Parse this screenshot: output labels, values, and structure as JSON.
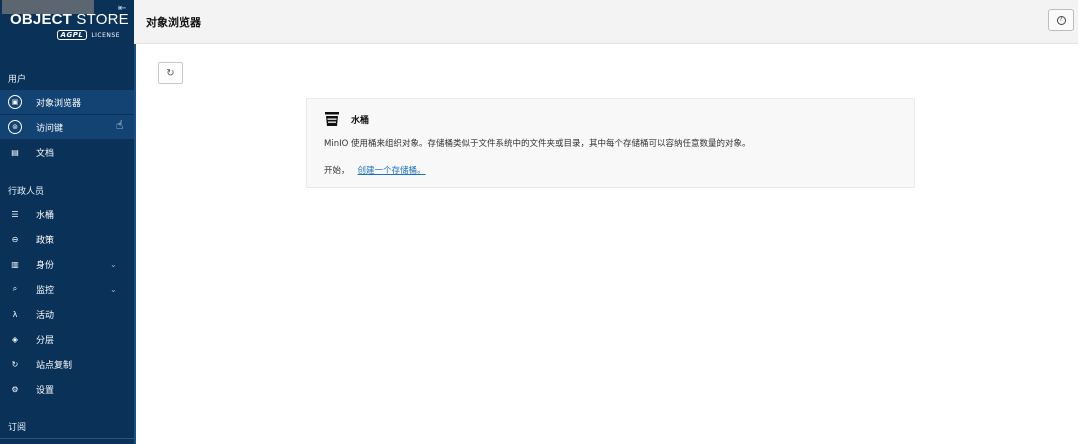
{
  "sidebar": {
    "logo": {
      "main_bold": "OBJECT",
      "main_light": "STORE",
      "badge": "AGPL",
      "license": "LICENSE"
    },
    "sections": {
      "user": "用户",
      "admin": "行政人员",
      "subscription": "订阅"
    },
    "items": [
      {
        "label": "对象浏览器",
        "icon": "object-browser-icon"
      },
      {
        "label": "访问键",
        "icon": "access-keys-icon"
      },
      {
        "label": "文档",
        "icon": "documentation-icon"
      },
      {
        "label": "水桶",
        "icon": "bucket-icon"
      },
      {
        "label": "政策",
        "icon": "policies-icon"
      },
      {
        "label": "身份",
        "icon": "identity-icon"
      },
      {
        "label": "监控",
        "icon": "monitoring-icon"
      },
      {
        "label": "活动",
        "icon": "events-icon"
      },
      {
        "label": "分层",
        "icon": "tiers-icon"
      },
      {
        "label": "站点复制",
        "icon": "site-replication-icon"
      },
      {
        "label": "设置",
        "icon": "settings-icon"
      }
    ]
  },
  "header": {
    "title": "对象浏览器",
    "help_icon": "question-icon"
  },
  "main": {
    "card": {
      "title": "水桶",
      "description": "MinIO 使用桶来组织对象。存储桶类似于文件系统中的文件夹或目录，其中每个存储桶可以容纳任意数量的对象。",
      "start_label": "开始，",
      "create_link": "创建一个存储桶。"
    }
  },
  "colors": {
    "sidebar_bg": "#0a3258",
    "active_bg": "#124373",
    "link": "#1c72b8"
  }
}
